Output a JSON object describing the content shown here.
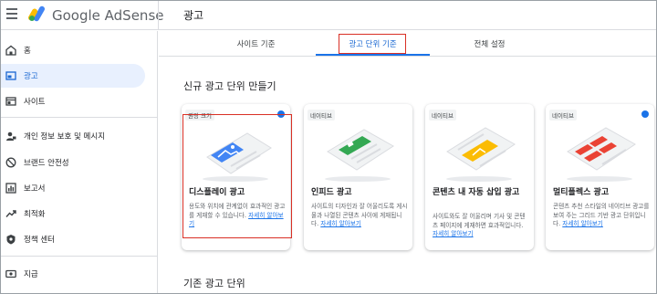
{
  "header": {
    "logo_text": "Google AdSense",
    "page_title": "광고"
  },
  "sidebar": {
    "items": [
      {
        "label": "홈",
        "icon": "home-icon"
      },
      {
        "label": "광고",
        "icon": "ads-icon",
        "active": true
      },
      {
        "label": "사이트",
        "icon": "sites-icon"
      },
      {
        "label": "개인 정보 보호 및 메시지",
        "icon": "privacy-icon"
      },
      {
        "label": "브랜드 안전성",
        "icon": "brand-safety-icon"
      },
      {
        "label": "보고서",
        "icon": "reports-icon"
      },
      {
        "label": "최적화",
        "icon": "optimization-icon"
      },
      {
        "label": "정책 센터",
        "icon": "policy-center-icon"
      },
      {
        "label": "지급",
        "icon": "payments-icon"
      }
    ]
  },
  "tabs": [
    {
      "label": "사이트 기준"
    },
    {
      "label": "광고 단위 기준",
      "active": true
    },
    {
      "label": "전체 설정"
    }
  ],
  "main": {
    "new_section_title": "신규 광고 단위 만들기",
    "existing_section_title": "기존 광고 단위",
    "cards": [
      {
        "badge": "권장 크기",
        "title": "디스플레이 광고",
        "desc": "용도와 위치에 관계없이 효과적인 광고를 게재할 수 있습니다.",
        "link": "자세히 알아보기",
        "new": true
      },
      {
        "badge": "네이티브",
        "title": "인피드 광고",
        "desc": "사이트의 디자인과 잘 어울리도록 게시물과 나열된 콘텐츠 사이에 게재됩니다.",
        "link": "자세히 알아보기",
        "new": false
      },
      {
        "badge": "네이티브",
        "title": "콘텐츠 내 자동 삽입 광고",
        "desc": "사이트와도 잘 어울리며 기사 및 콘텐츠 페이지에 게재하면 효과적입니다.",
        "link": "자세히 알아보기",
        "new": false
      },
      {
        "badge": "네이티브",
        "title": "멀티플렉스 광고",
        "desc": "콘텐츠 추천 스타일의 네이티브 광고를 보여 주는 그리드 기반 광고 단위입니다.",
        "link": "자세히 알아보기",
        "new": true
      }
    ]
  },
  "colors": {
    "accent": "#1a73e8",
    "highlight": "#d93025",
    "display_illus": "#4285f4",
    "infeed_illus": "#34a853",
    "inarticle_illus": "#fbbc04",
    "multiplex_illus": "#ea4335"
  }
}
